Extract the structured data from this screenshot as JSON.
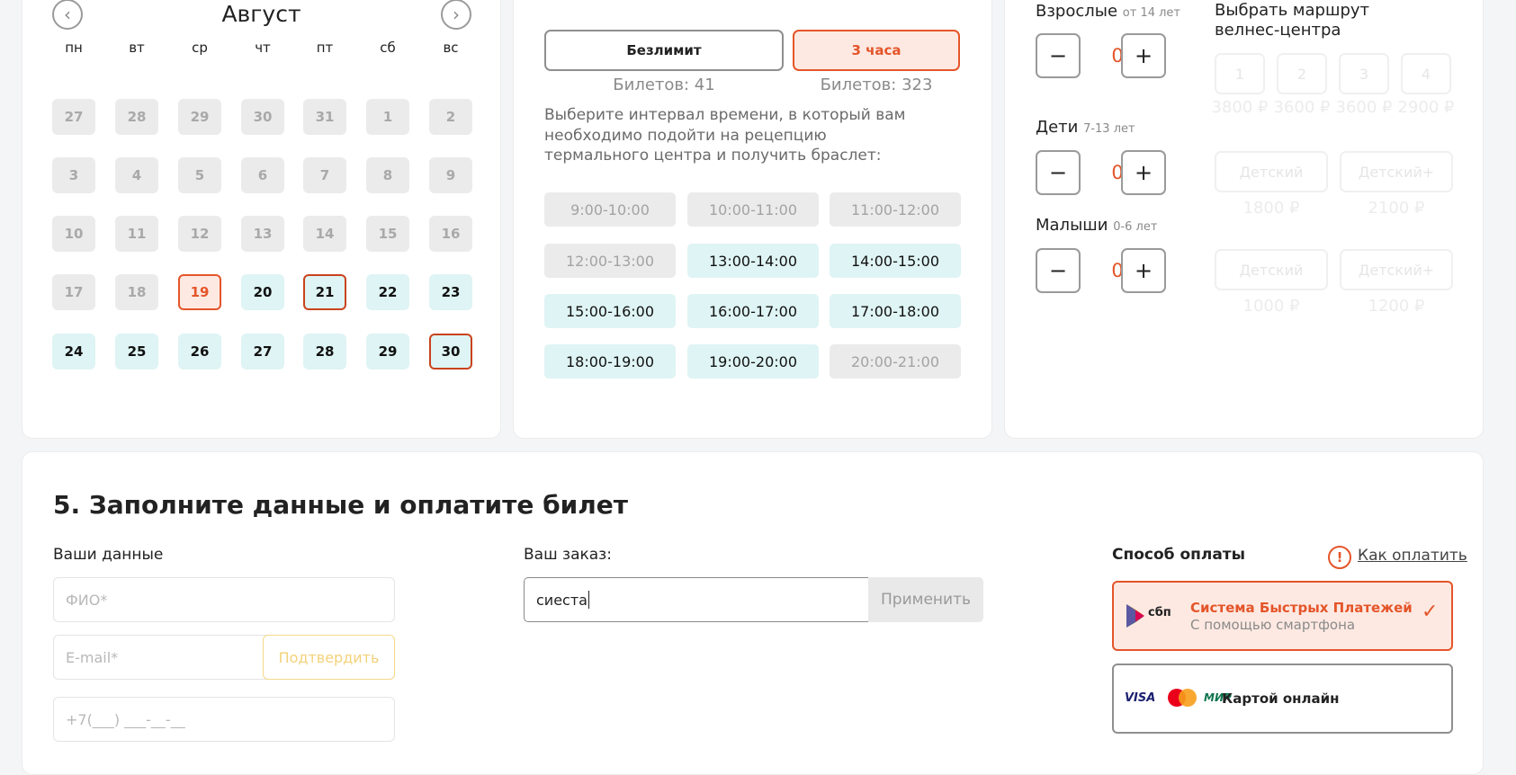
{
  "calendar": {
    "month": "Август",
    "weekdays": [
      "пн",
      "вт",
      "ср",
      "чт",
      "пт",
      "сб",
      "вс"
    ],
    "rows": [
      [
        {
          "d": "27",
          "s": "dis"
        },
        {
          "d": "28",
          "s": "dis"
        },
        {
          "d": "29",
          "s": "dis"
        },
        {
          "d": "30",
          "s": "dis"
        },
        {
          "d": "31",
          "s": "dis"
        },
        {
          "d": "1",
          "s": "dis"
        },
        {
          "d": "2",
          "s": "dis"
        }
      ],
      [
        {
          "d": "3",
          "s": "dis"
        },
        {
          "d": "4",
          "s": "dis"
        },
        {
          "d": "5",
          "s": "dis"
        },
        {
          "d": "6",
          "s": "dis"
        },
        {
          "d": "7",
          "s": "dis"
        },
        {
          "d": "8",
          "s": "dis"
        },
        {
          "d": "9",
          "s": "dis"
        }
      ],
      [
        {
          "d": "10",
          "s": "dis"
        },
        {
          "d": "11",
          "s": "dis"
        },
        {
          "d": "12",
          "s": "dis"
        },
        {
          "d": "13",
          "s": "dis"
        },
        {
          "d": "14",
          "s": "dis"
        },
        {
          "d": "15",
          "s": "dis"
        },
        {
          "d": "16",
          "s": "dis"
        }
      ],
      [
        {
          "d": "17",
          "s": "dis"
        },
        {
          "d": "18",
          "s": "dis"
        },
        {
          "d": "19",
          "s": "today"
        },
        {
          "d": "20",
          "s": "av"
        },
        {
          "d": "21",
          "s": "av sel"
        },
        {
          "d": "22",
          "s": "av"
        },
        {
          "d": "23",
          "s": "av"
        }
      ],
      [
        {
          "d": "24",
          "s": "av"
        },
        {
          "d": "25",
          "s": "av"
        },
        {
          "d": "26",
          "s": "av"
        },
        {
          "d": "27",
          "s": "av"
        },
        {
          "d": "28",
          "s": "av"
        },
        {
          "d": "29",
          "s": "av"
        },
        {
          "d": "30",
          "s": "av sel"
        }
      ]
    ]
  },
  "tickets": {
    "types": [
      {
        "label": "Безлимит",
        "count": "Билетов: 41",
        "selected": false
      },
      {
        "label": "3 часа",
        "count": "Билетов: 323",
        "selected": true
      }
    ],
    "interval_text": "Выберите интервал времени, в который вам необходимо подойти на рецепцию термального центра и получить браслет:",
    "slots": [
      {
        "t": "9:00-10:00",
        "s": "dis"
      },
      {
        "t": "10:00-11:00",
        "s": "dis"
      },
      {
        "t": "11:00-12:00",
        "s": "dis"
      },
      {
        "t": "12:00-13:00",
        "s": "dis"
      },
      {
        "t": "13:00-14:00",
        "s": "av"
      },
      {
        "t": "14:00-15:00",
        "s": "av"
      },
      {
        "t": "15:00-16:00",
        "s": "av"
      },
      {
        "t": "16:00-17:00",
        "s": "av"
      },
      {
        "t": "17:00-18:00",
        "s": "av"
      },
      {
        "t": "18:00-19:00",
        "s": "av"
      },
      {
        "t": "19:00-20:00",
        "s": "av"
      },
      {
        "t": "20:00-21:00",
        "s": "dis"
      }
    ]
  },
  "guests": {
    "adults": {
      "label": "Взрослые",
      "note": "от 14 лет",
      "value": "0"
    },
    "children": {
      "label": "Дети",
      "note": "7-13 лет",
      "value": "0"
    },
    "babies": {
      "label": "Малыши",
      "note": "0-6 лет",
      "value": "0"
    },
    "minus": "−",
    "plus": "+"
  },
  "routes": {
    "title": "Выбрать маршрут велнес-центра",
    "numbers": [
      "1",
      "2",
      "3",
      "4"
    ],
    "prices": [
      "3800 ₽",
      "3600 ₽",
      "3600 ₽",
      "2900 ₽"
    ],
    "kids1": [
      {
        "label": "Детский",
        "price": "1800 ₽"
      },
      {
        "label": "Детский+",
        "price": "2100 ₽"
      }
    ],
    "kids2": [
      {
        "label": "Детский",
        "price": "1000 ₽"
      },
      {
        "label": "Детский+",
        "price": "1200 ₽"
      }
    ]
  },
  "form": {
    "title": "5. Заполните данные и оплатите билет",
    "your_data": "Ваши данные",
    "fio_placeholder": "ФИО*",
    "email_placeholder": "E-mail*",
    "confirm": "Подтвердить",
    "phone_placeholder": "+7(___) ___-__-__",
    "order_label": "Ваш заказ:",
    "promo_value": "сиеста",
    "apply": "Применить",
    "payment_label": "Способ оплаты",
    "how_to_pay": "Как оплатить",
    "sbp_title": "Система Быстрых Платежей",
    "sbp_sub": "С помощью смартфона",
    "sbp_logo": "сбп",
    "card_title": "Картой онлайн",
    "card_logos": {
      "visa": "VISA",
      "mir": "МИР"
    }
  },
  "colors": {
    "accent": "#e4552a",
    "available": "#dff4f4",
    "disabled": "#ebebeb"
  }
}
